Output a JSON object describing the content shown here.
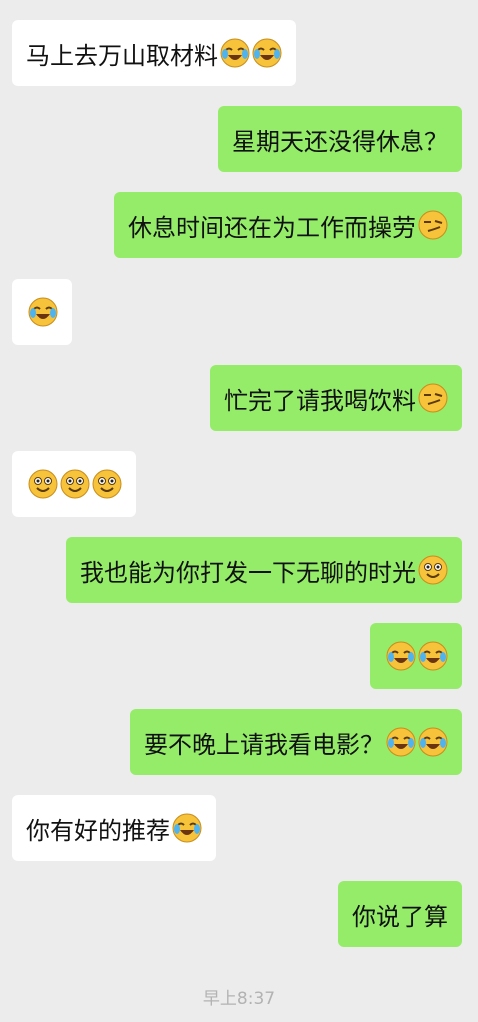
{
  "messages": [
    {
      "side": "left",
      "text": "马上去万山取材料",
      "emojis": [
        "cry-laugh-emoji",
        "cry-laugh-emoji"
      ]
    },
    {
      "side": "right",
      "text": "星期天还没得休息？",
      "emojis": []
    },
    {
      "side": "right",
      "text": "休息时间还在为工作而操劳",
      "emojis": [
        "smirk-emoji"
      ]
    },
    {
      "side": "left",
      "text": "",
      "emojis": [
        "cry-laugh-emoji"
      ]
    },
    {
      "side": "right",
      "text": "忙完了请我喝饮料",
      "emojis": [
        "smirk-emoji"
      ]
    },
    {
      "side": "left",
      "text": "",
      "emojis": [
        "grin-emoji",
        "grin-emoji",
        "grin-emoji"
      ]
    },
    {
      "side": "right",
      "text": "我也能为你打发一下无聊的时光",
      "emojis": [
        "grin-emoji"
      ]
    },
    {
      "side": "right",
      "text": "",
      "emojis": [
        "cry-laugh-emoji",
        "cry-laugh-emoji"
      ]
    },
    {
      "side": "right",
      "text": "要不晚上请我看电影？",
      "emojis": [
        "cry-laugh-emoji",
        "cry-laugh-emoji"
      ]
    },
    {
      "side": "left",
      "text": "你有好的推荐",
      "emojis": [
        "cry-laugh-emoji"
      ]
    },
    {
      "side": "right",
      "text": "你说了算",
      "emojis": []
    }
  ],
  "timestamp": "早上8:37",
  "colors": {
    "background": "#ececec",
    "left_bubble": "#ffffff",
    "right_bubble": "#95ec69",
    "emoji_face": "#f6c33b"
  }
}
